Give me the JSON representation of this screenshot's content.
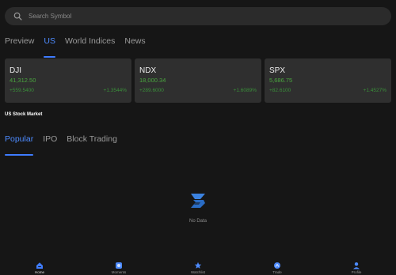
{
  "search": {
    "placeholder": "Search Symbol"
  },
  "market_tabs": [
    "Preview",
    "US",
    "World Indices",
    "News"
  ],
  "market_tabs_active": "US",
  "indices": [
    {
      "symbol": "DJI",
      "price": "41,312.50",
      "change": "+559.5400",
      "percent": "+1.3544%"
    },
    {
      "symbol": "NDX",
      "price": "18,000.34",
      "change": "+289.6000",
      "percent": "+1.6089%"
    },
    {
      "symbol": "SPX",
      "price": "5,686.75",
      "change": "+82.6100",
      "percent": "+1.4527%"
    }
  ],
  "section_title": "US Stock Market",
  "sub_tabs": [
    "Popular",
    "IPO",
    "Block Trading"
  ],
  "sub_tabs_active": "Popular",
  "empty_state": {
    "label": "No Data"
  },
  "bottom_nav": [
    {
      "label": "Home",
      "icon": "home-icon"
    },
    {
      "label": "Moments",
      "icon": "moments-icon"
    },
    {
      "label": "Watchlist",
      "icon": "watchlist-icon"
    },
    {
      "label": "Trade",
      "icon": "trade-icon"
    },
    {
      "label": "Profile",
      "icon": "profile-icon"
    }
  ],
  "colors": {
    "accent": "#3f7cff",
    "up": "#4aa63f",
    "background": "#161616",
    "card": "#2f2f2f"
  }
}
